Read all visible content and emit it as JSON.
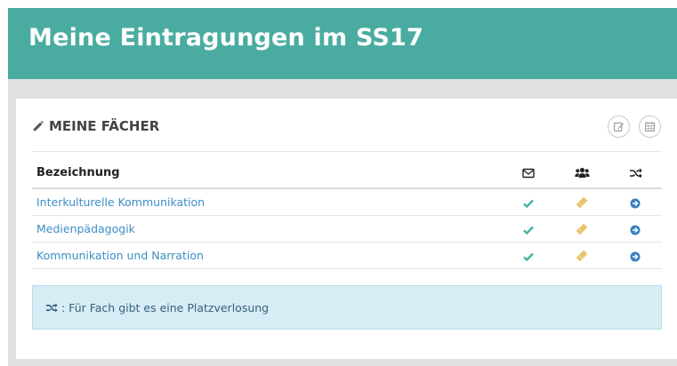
{
  "header": {
    "title": "Meine Eintragungen im SS17"
  },
  "panel": {
    "title": "MEINE FÄCHER",
    "actions": [
      {
        "icon": "edit-icon"
      },
      {
        "icon": "calendar-icon"
      }
    ]
  },
  "table": {
    "columns": [
      {
        "label": "Bezeichnung"
      },
      {
        "icon": "envelope-icon"
      },
      {
        "icon": "group-icon"
      },
      {
        "icon": "random-icon"
      }
    ],
    "rows": [
      {
        "name": "Interkulturelle Kommunikation",
        "status_icons": [
          "check-icon",
          "ticket-icon",
          "arrow-circle-right-icon"
        ]
      },
      {
        "name": "Medienpädagogik",
        "status_icons": [
          "check-icon",
          "ticket-icon",
          "arrow-circle-right-icon"
        ]
      },
      {
        "name": "Kommunikation und Narration",
        "status_icons": [
          "check-icon",
          "ticket-icon",
          "arrow-circle-right-icon"
        ]
      }
    ]
  },
  "info": {
    "text": ": Für Fach gibt es eine Platzverlosung",
    "icon": "random-icon"
  },
  "colors": {
    "header": "#4aaca0",
    "link": "#3b8fc4",
    "check": "#3fb3a3",
    "ticket": "#e8c46b",
    "arrow": "#3a7fc4",
    "info_bg": "#d8ecf5"
  }
}
